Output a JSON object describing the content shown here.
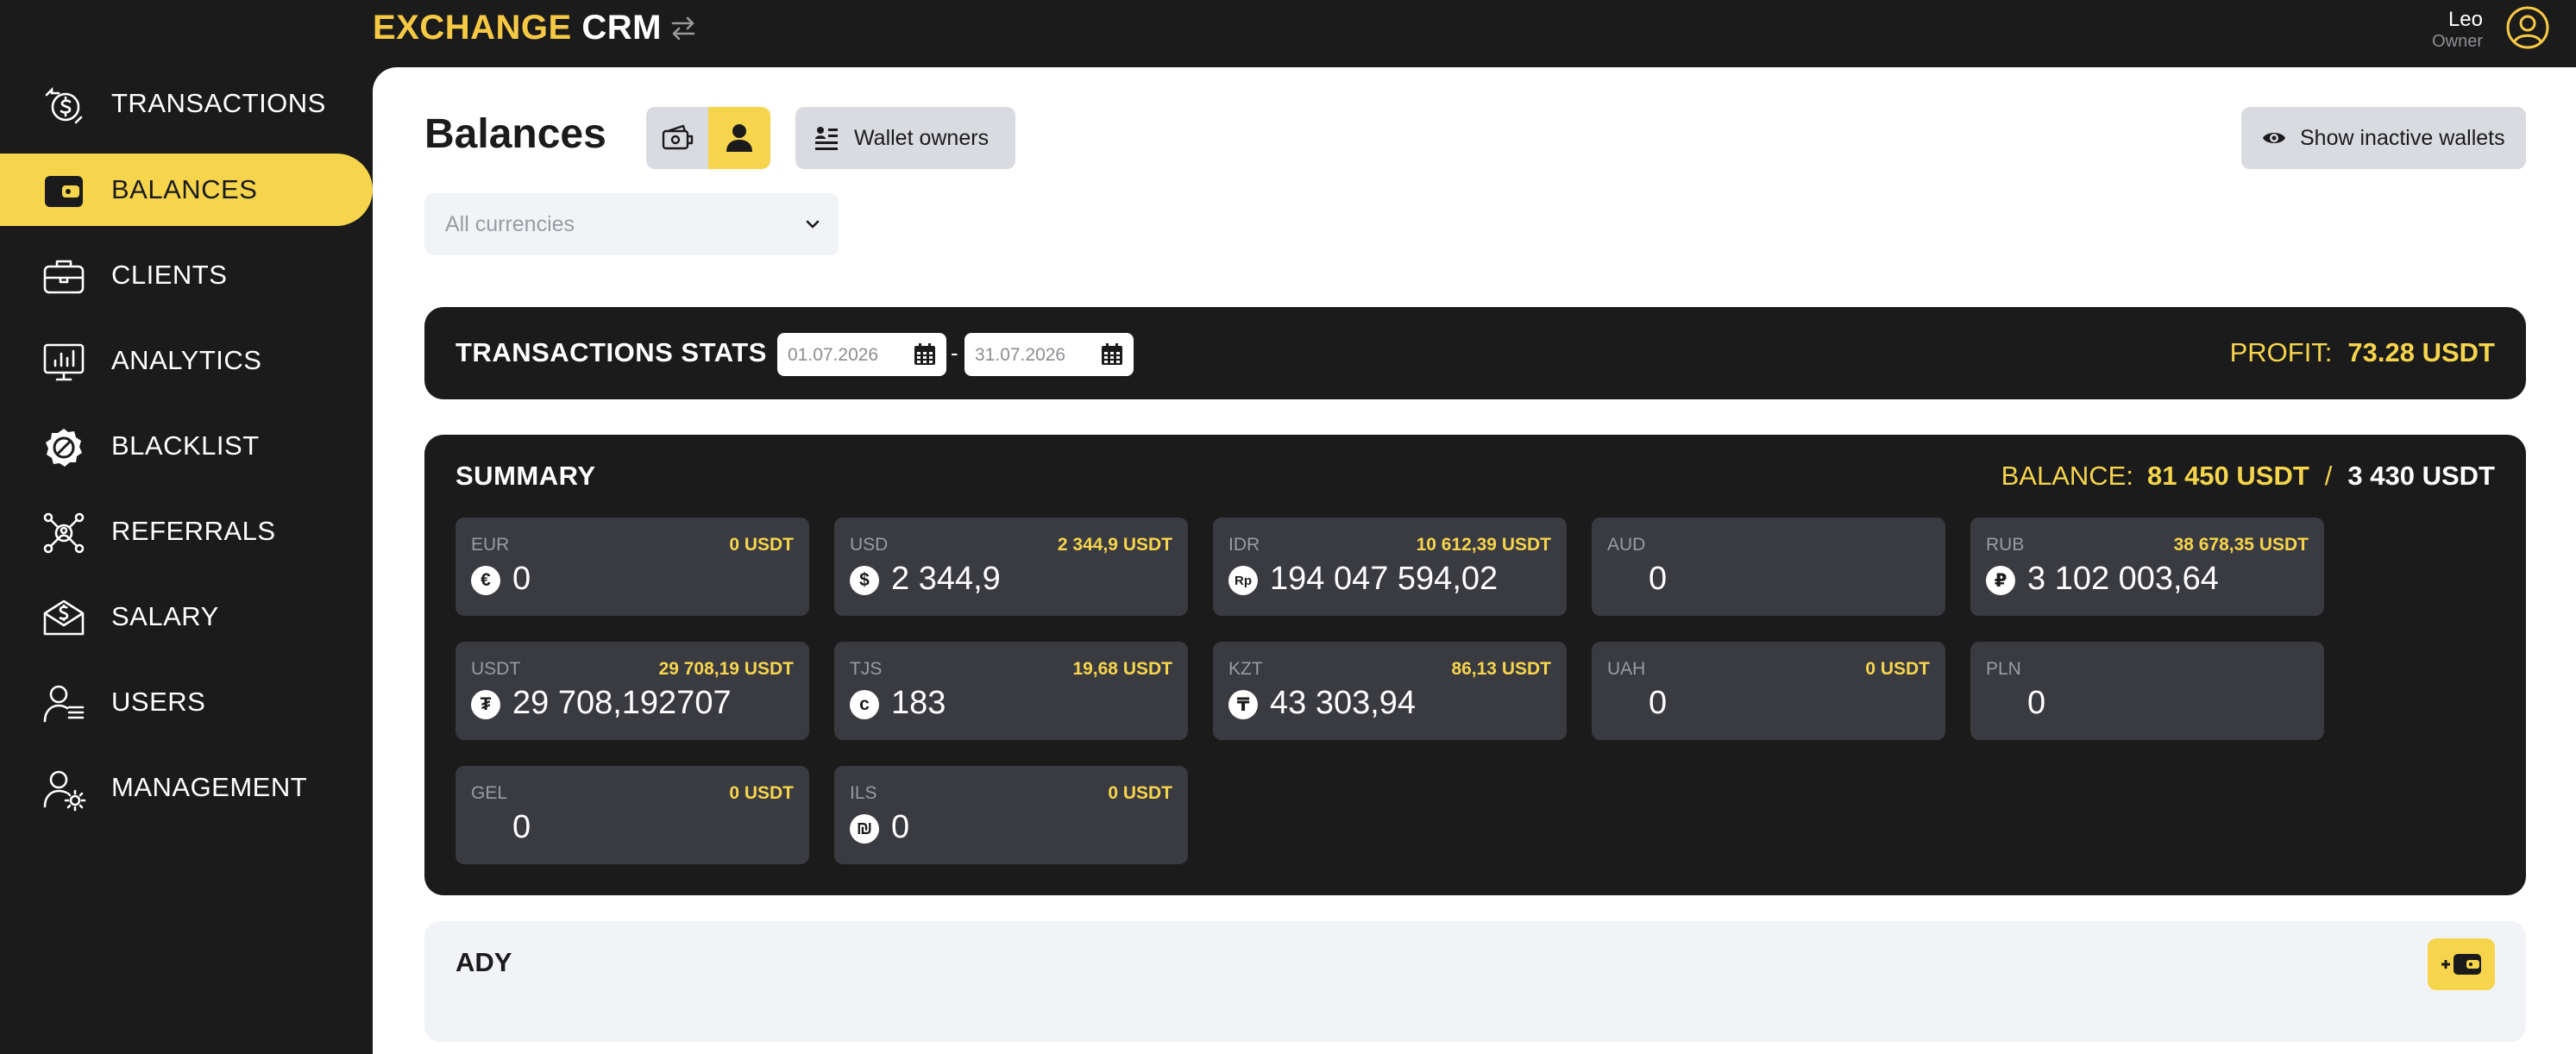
{
  "header": {
    "logo_part1": "EXCHANGE",
    "logo_part2": "CRM",
    "user_name": "Leo",
    "user_role": "Owner"
  },
  "sidebar": {
    "items": [
      {
        "label": "TRANSACTIONS",
        "icon": "transactions-icon"
      },
      {
        "label": "BALANCES",
        "icon": "wallet-icon",
        "active": true
      },
      {
        "label": "CLIENTS",
        "icon": "briefcase-icon"
      },
      {
        "label": "ANALYTICS",
        "icon": "analytics-icon"
      },
      {
        "label": "BLACKLIST",
        "icon": "blacklist-icon"
      },
      {
        "label": "REFERRALS",
        "icon": "referrals-icon"
      },
      {
        "label": "SALARY",
        "icon": "salary-icon"
      },
      {
        "label": "USERS",
        "icon": "users-icon"
      },
      {
        "label": "MANAGEMENT",
        "icon": "management-icon"
      }
    ]
  },
  "main": {
    "title": "Balances",
    "wallet_owners_label": "Wallet owners",
    "show_inactive_label": "Show inactive wallets",
    "currency_filter_placeholder": "All currencies"
  },
  "stats": {
    "title": "TRANSACTIONS STATS",
    "date_from": "01.07.2026",
    "date_to": "31.07.2026",
    "separator": "-",
    "profit_label": "PROFIT:",
    "profit_value": "73.28 USDT"
  },
  "summary": {
    "title": "SUMMARY",
    "balance_label": "BALANCE:",
    "balance_value": "81 450 USDT",
    "balance_separator": "/",
    "balance_value2": "3 430 USDT",
    "cards": [
      {
        "code": "EUR",
        "usdt": "0 USDT",
        "symbol": "€",
        "amount": "0"
      },
      {
        "code": "USD",
        "usdt": "2 344,9 USDT",
        "symbol": "$",
        "amount": "2 344,9"
      },
      {
        "code": "IDR",
        "usdt": "10 612,39 USDT",
        "symbol": "Rp",
        "amount": "194 047 594,02"
      },
      {
        "code": "AUD",
        "usdt": "",
        "symbol": "",
        "amount": "0"
      },
      {
        "code": "RUB",
        "usdt": "38 678,35 USDT",
        "symbol": "₽",
        "amount": "3 102 003,64"
      },
      {
        "code": "USDT",
        "usdt": "29 708,19 USDT",
        "symbol": "₮",
        "amount": "29 708,192707"
      },
      {
        "code": "TJS",
        "usdt": "19,68 USDT",
        "symbol": "c",
        "amount": "183"
      },
      {
        "code": "KZT",
        "usdt": "86,13 USDT",
        "symbol": "₸",
        "amount": "43 303,94"
      },
      {
        "code": "UAH",
        "usdt": "0 USDT",
        "symbol": "",
        "amount": "0"
      },
      {
        "code": "PLN",
        "usdt": "",
        "symbol": "",
        "amount": "0"
      },
      {
        "code": "GEL",
        "usdt": "0 USDT",
        "symbol": "",
        "amount": "0"
      },
      {
        "code": "ILS",
        "usdt": "0 USDT",
        "symbol": "₪",
        "amount": "0"
      }
    ]
  },
  "wallet": {
    "title": "ADY",
    "add_label": "+"
  },
  "colors": {
    "accent": "#f6d54d",
    "dark": "#1b1b1c",
    "card": "#3a3a41"
  }
}
